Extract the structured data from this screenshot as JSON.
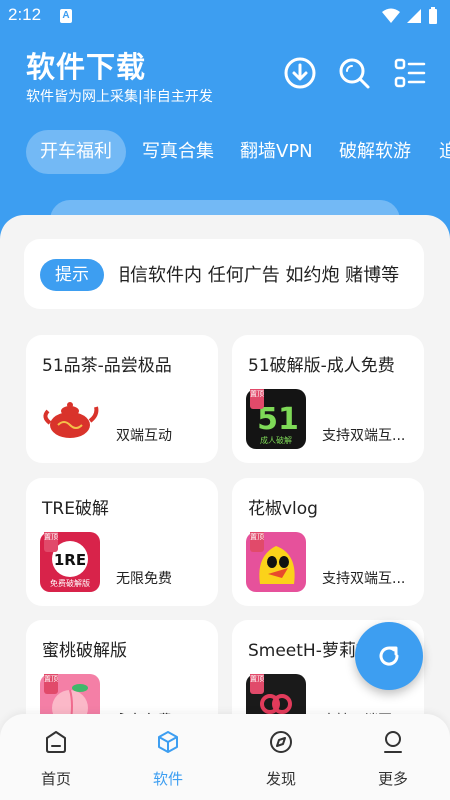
{
  "status_bar": {
    "time": "2:12",
    "sim_label": "A"
  },
  "header": {
    "title": "软件下载",
    "subtitle": "软件皆为网上采集|非自主开发",
    "icons": [
      "download-icon",
      "search-icon",
      "menu-list-icon"
    ]
  },
  "tabs": [
    {
      "label": "开车福利",
      "active": true
    },
    {
      "label": "写真合集",
      "active": false
    },
    {
      "label": "翻墙VPN",
      "active": false
    },
    {
      "label": "破解软游",
      "active": false
    },
    {
      "label": "追",
      "active": false
    }
  ],
  "notice": {
    "pill": "提示",
    "text": "相信软件内 任何广告 如约炮 赌博等"
  },
  "apps": [
    {
      "name": "51品茶-品尝极品",
      "desc": "双端互动",
      "top_badge": ""
    },
    {
      "name": "51破解版-成人免费",
      "desc": "支持双端互...",
      "top_badge": "置顶",
      "icon_text": "51",
      "icon_subtext": "成人破解"
    },
    {
      "name": "TRE破解",
      "desc": "无限免费",
      "top_badge": "置顶",
      "icon_text": "1RE",
      "icon_subtext": "免费破解版"
    },
    {
      "name": "花椒vlog",
      "desc": "支持双端互...",
      "top_badge": "置顶"
    },
    {
      "name": "蜜桃破解版",
      "desc": "永久免费",
      "top_badge": "置顶"
    },
    {
      "name": "SmeetH-萝莉御",
      "desc": "支持双端互...",
      "top_badge": "置顶"
    }
  ],
  "bottom_nav": [
    {
      "label": "首页",
      "icon": "home-icon",
      "active": false
    },
    {
      "label": "软件",
      "icon": "cube-icon",
      "active": true
    },
    {
      "label": "发现",
      "icon": "compass-icon",
      "active": false
    },
    {
      "label": "更多",
      "icon": "person-icon",
      "active": false
    }
  ],
  "colors": {
    "primary": "#3d9ef1",
    "background": "#f4f4f4",
    "card": "#ffffff"
  }
}
